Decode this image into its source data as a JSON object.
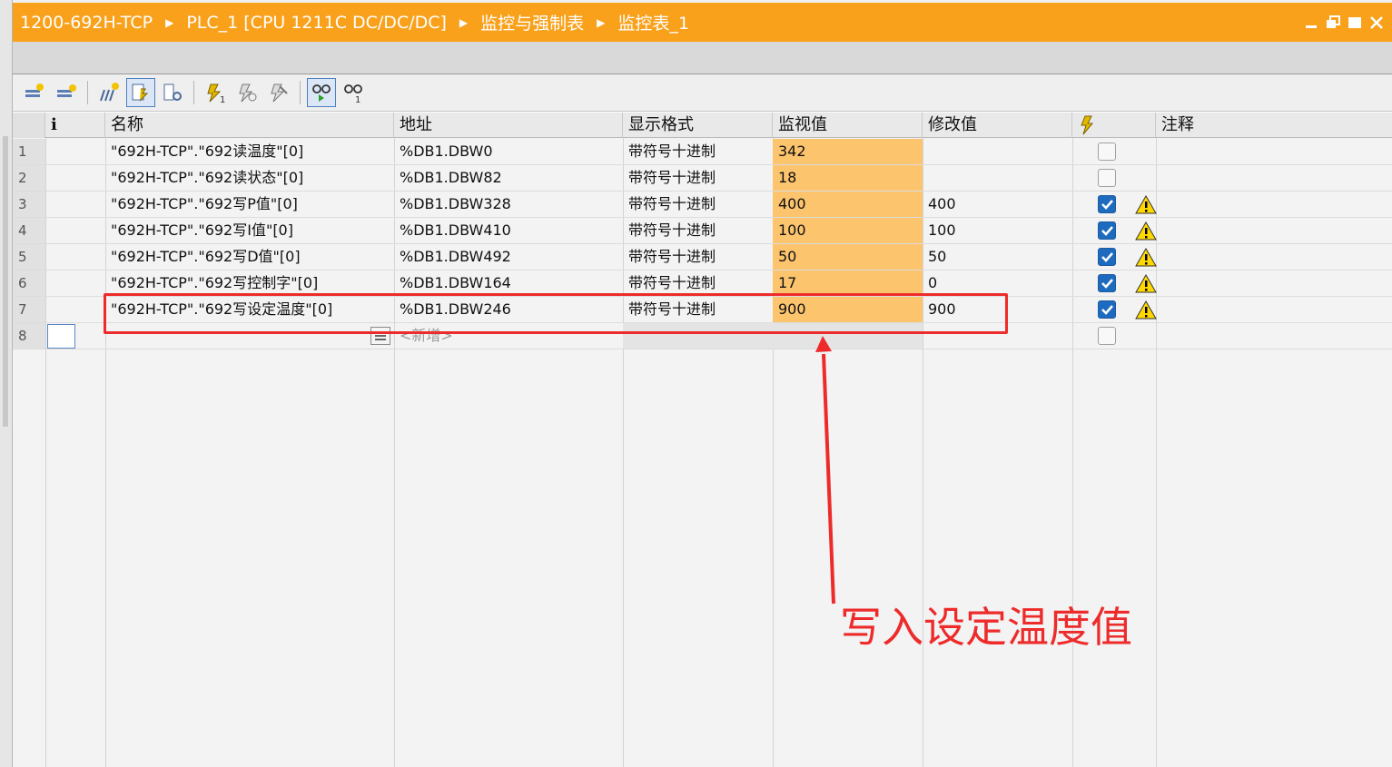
{
  "breadcrumb": [
    "1200-692H-TCP",
    "PLC_1 [CPU 1211C DC/DC/DC]",
    "监控与强制表",
    "监控表_1"
  ],
  "toolbar": {
    "icons": [
      "insert-row-icon",
      "add-row-icon",
      "insert-comment-row-icon",
      "force-values-icon",
      "extended-mode-icon",
      "modify-now-icon",
      "modify-trigger-icon",
      "disable-peripheral-icon",
      "monitor-all-icon",
      "monitor-once-icon"
    ]
  },
  "table": {
    "headers": {
      "info": "i",
      "name": "名称",
      "address": "地址",
      "format": "显示格式",
      "monitor": "监视值",
      "modify": "修改值",
      "comment": "注释"
    },
    "rows": [
      {
        "n": "1",
        "name": "\"692H-TCP\".\"692读温度\"[0]",
        "address": "%DB1.DBW0",
        "format": "带符号十进制",
        "monitor": "342",
        "modify": "",
        "checked": false,
        "warn": false
      },
      {
        "n": "2",
        "name": "\"692H-TCP\".\"692读状态\"[0]",
        "address": "%DB1.DBW82",
        "format": "带符号十进制",
        "monitor": "18",
        "modify": "",
        "checked": false,
        "warn": false
      },
      {
        "n": "3",
        "name": "\"692H-TCP\".\"692写P值\"[0]",
        "address": "%DB1.DBW328",
        "format": "带符号十进制",
        "monitor": "400",
        "modify": "400",
        "checked": true,
        "warn": true
      },
      {
        "n": "4",
        "name": "\"692H-TCP\".\"692写I值\"[0]",
        "address": "%DB1.DBW410",
        "format": "带符号十进制",
        "monitor": "100",
        "modify": "100",
        "checked": true,
        "warn": true
      },
      {
        "n": "5",
        "name": "\"692H-TCP\".\"692写D值\"[0]",
        "address": "%DB1.DBW492",
        "format": "带符号十进制",
        "monitor": "50",
        "modify": "50",
        "checked": true,
        "warn": true
      },
      {
        "n": "6",
        "name": "\"692H-TCP\".\"692写控制字\"[0]",
        "address": "%DB1.DBW164",
        "format": "带符号十进制",
        "monitor": "17",
        "modify": "0",
        "checked": true,
        "warn": true
      },
      {
        "n": "7",
        "name": "\"692H-TCP\".\"692写设定温度\"[0]",
        "address": "%DB1.DBW246",
        "format": "带符号十进制",
        "monitor": "900",
        "modify": "900",
        "checked": true,
        "warn": true
      }
    ],
    "new_row": {
      "n": "8",
      "placeholder": "<新增>",
      "checked": false
    }
  },
  "annotation": {
    "text": "写入设定温度值",
    "color": "#ee2b2b"
  },
  "colors": {
    "titlebar": "#f9a11b",
    "monitor_cell": "#fcc46d",
    "checkbox_on": "#1d6bbf",
    "annotation": "#ee2b2b"
  }
}
